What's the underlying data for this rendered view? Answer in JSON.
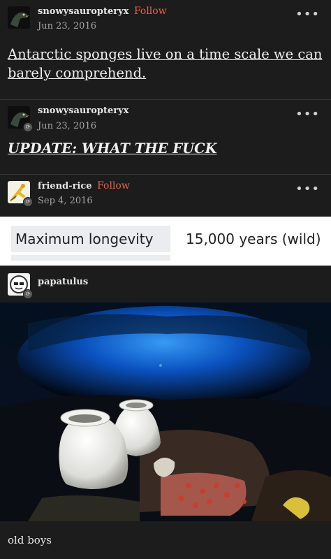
{
  "post1": {
    "username": "snowysauropteryx",
    "follow_label": "Follow",
    "date": "Jun 23, 2016",
    "body": "Antarctic sponges live on a time scale we can barely comprehend."
  },
  "post2": {
    "username": "snowysauropteryx",
    "date": "Jun 23, 2016",
    "body": "UPDATE: WHAT THE FUCK"
  },
  "post3": {
    "username": "friend-rice",
    "follow_label": "Follow",
    "date": "Sep 4, 2016",
    "table": {
      "label": "Maximum longevity",
      "value": "15,000 years (wild)"
    }
  },
  "post4": {
    "username": "papatulus",
    "caption": "old boys"
  },
  "icons": {
    "more": "more-dots-icon",
    "reblog": "reblog-icon"
  },
  "colors": {
    "background": "#1c1c1c",
    "follow": "#e8604c",
    "divider": "#353535"
  }
}
